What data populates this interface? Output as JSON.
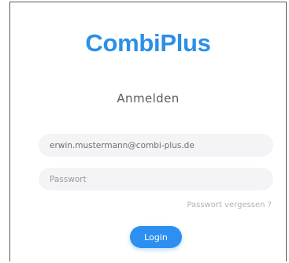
{
  "brand": {
    "name": "CombiPlus",
    "color": "#2b8fe8"
  },
  "login": {
    "heading": "Anmelden",
    "email_value": "erwin.mustermann@combi-plus.de",
    "password_placeholder": "Passwort",
    "forgot_link": "Passwort vergessen ?",
    "submit_label": "Login",
    "accent_color": "#2d8ff0"
  }
}
